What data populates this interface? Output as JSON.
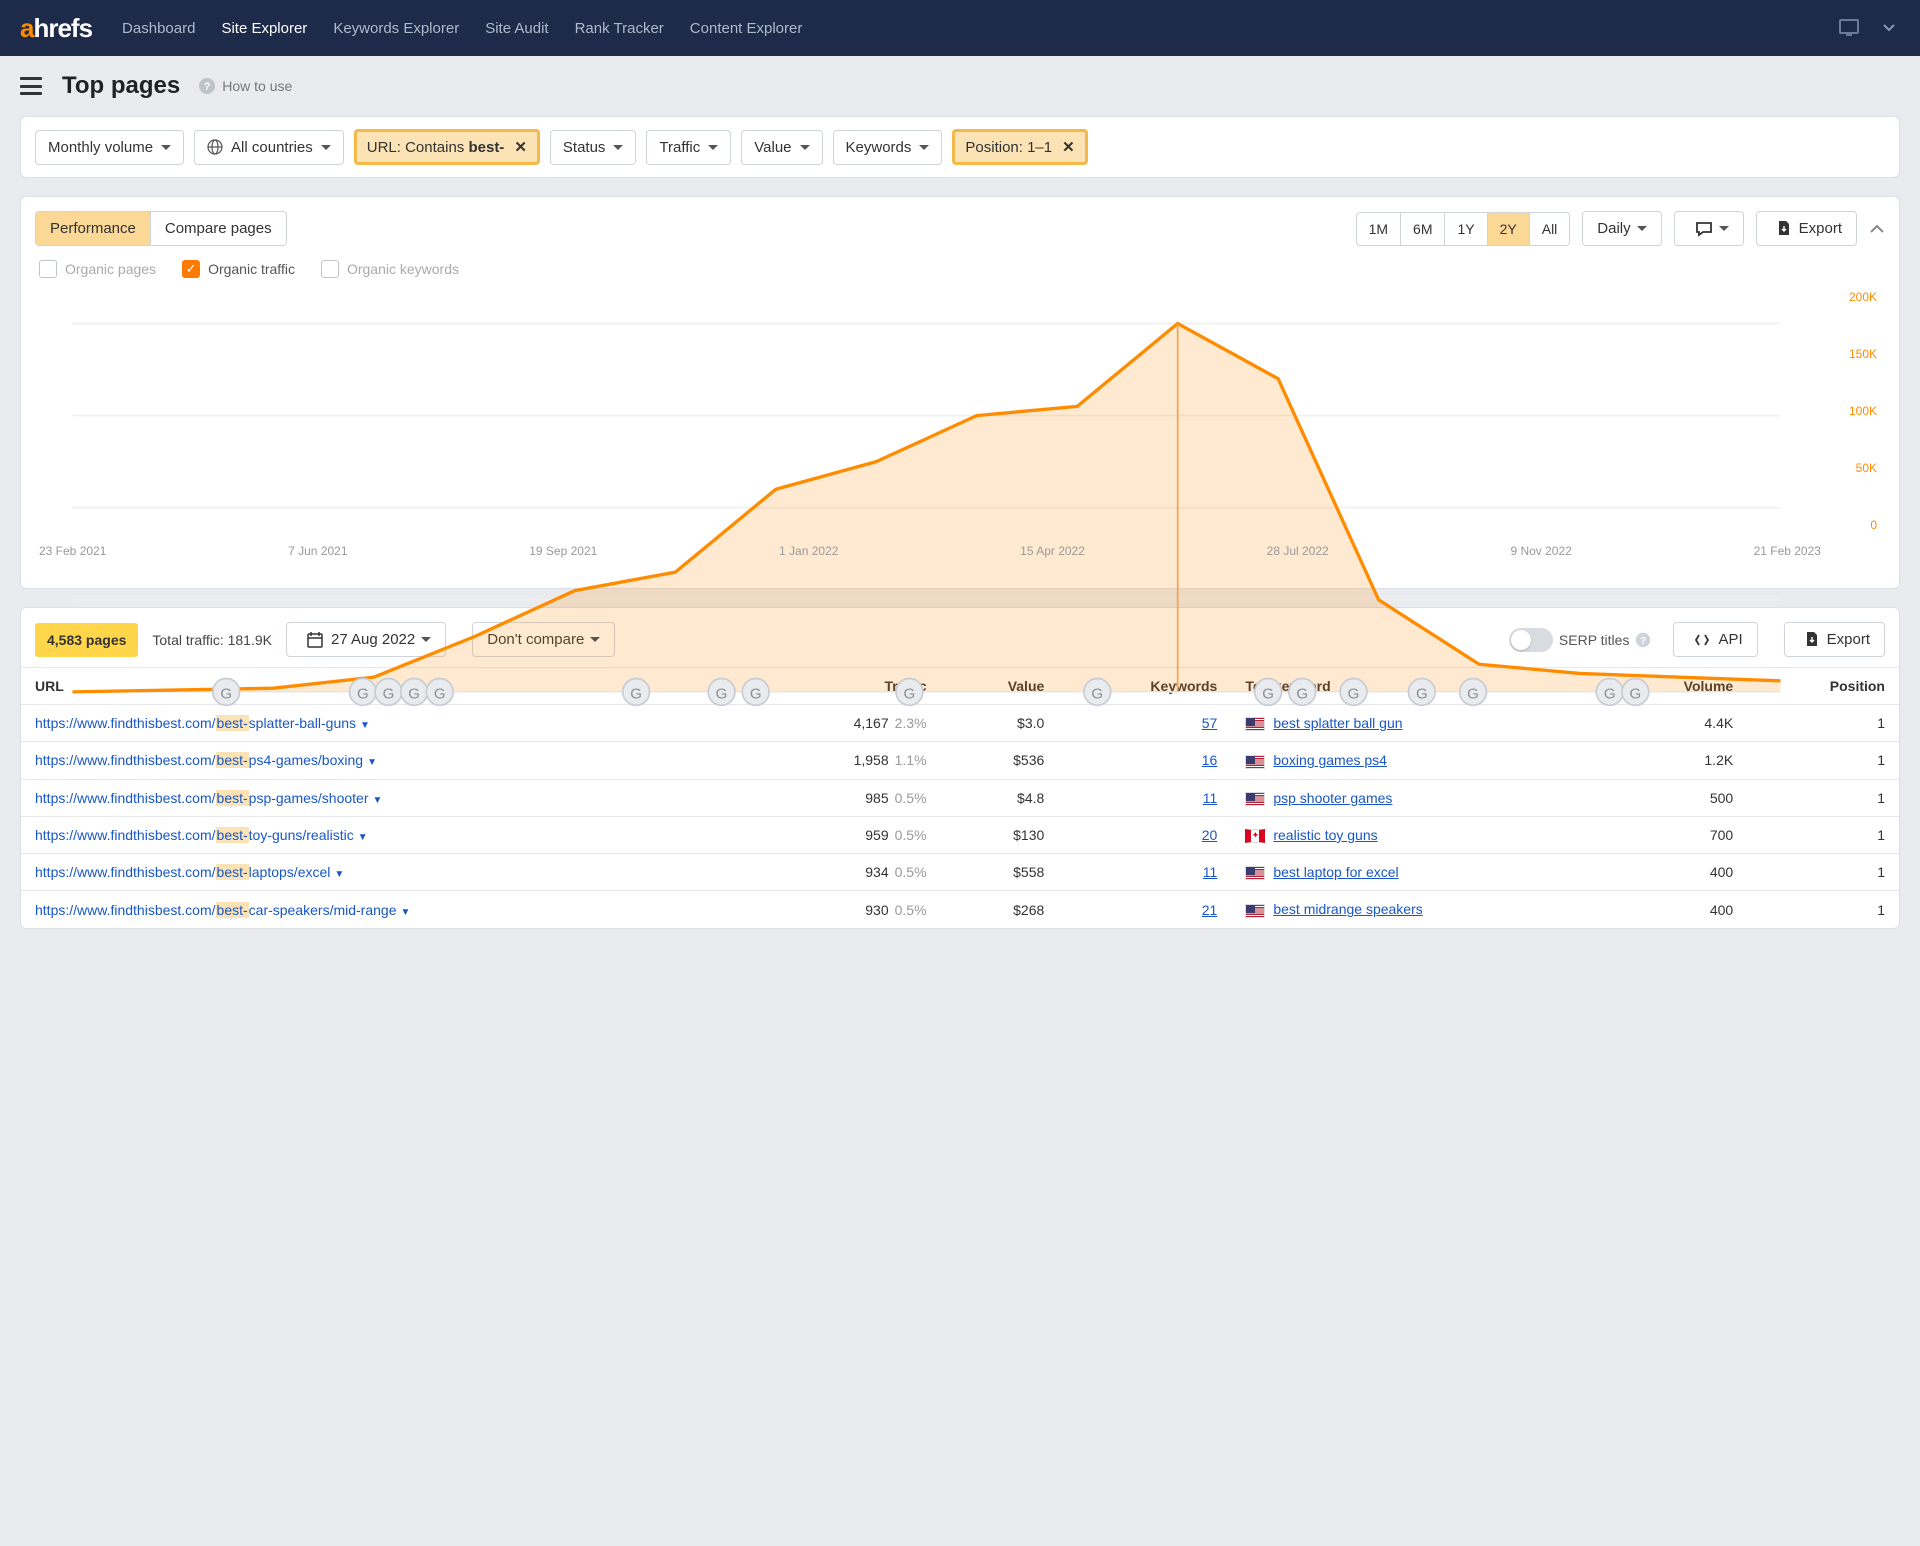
{
  "nav": {
    "logo_a": "a",
    "logo_rest": "hrefs",
    "items": [
      "Dashboard",
      "Site Explorer",
      "Keywords Explorer",
      "Site Audit",
      "Rank Tracker",
      "Content Explorer"
    ],
    "active_index": 1
  },
  "page": {
    "title": "Top pages",
    "how_to_use": "How to use"
  },
  "filters": {
    "monthly_volume": "Monthly volume",
    "countries": "All countries",
    "url_prefix": "URL: Contains ",
    "url_value": "best-",
    "status": "Status",
    "traffic": "Traffic",
    "value": "Value",
    "keywords": "Keywords",
    "position": "Position: 1–1"
  },
  "chart_panel": {
    "tabs": {
      "performance": "Performance",
      "compare": "Compare pages"
    },
    "ranges": [
      "1M",
      "6M",
      "1Y",
      "2Y",
      "All"
    ],
    "range_active": "2Y",
    "granularity": "Daily",
    "export": "Export",
    "legend": {
      "organic_pages": "Organic pages",
      "organic_traffic": "Organic traffic",
      "organic_keywords": "Organic keywords"
    }
  },
  "chart_data": {
    "type": "area",
    "title": "Organic traffic",
    "ylabel": "",
    "ylim": [
      0,
      200000
    ],
    "y_ticks": [
      "200K",
      "150K",
      "100K",
      "50K",
      "0"
    ],
    "x_ticks": [
      "23 Feb 2021",
      "7 Jun 2021",
      "19 Sep 2021",
      "1 Jan 2022",
      "15 Apr 2022",
      "28 Jul 2022",
      "9 Nov 2022",
      "21 Feb 2023"
    ],
    "series": [
      {
        "name": "Organic traffic",
        "color": "#ff8c00",
        "x": [
          "23 Feb 2021",
          "1 May 2021",
          "7 Jun 2021",
          "19 Sep 2021",
          "15 Nov 2021",
          "1 Jan 2022",
          "1 Feb 2022",
          "15 Apr 2022",
          "15 Jun 2022",
          "1 Jul 2022",
          "28 Jul 2022",
          "27 Aug 2022",
          "10 Sep 2022",
          "1 Oct 2022",
          "20 Oct 2022",
          "9 Nov 2022",
          "1 Dec 2022",
          "21 Feb 2023"
        ],
        "y": [
          0,
          1000,
          2000,
          8000,
          30000,
          55000,
          65000,
          110000,
          125000,
          150000,
          155000,
          200000,
          170000,
          50000,
          15000,
          10000,
          8000,
          6000
        ]
      }
    ],
    "markers": {
      "label": "G",
      "x": [
        "1 May 2021",
        "25 Jun 2021",
        "5 Jul 2021",
        "15 Jul 2021",
        "22 Jul 2021",
        "15 Nov 2021",
        "5 Dec 2021",
        "15 Dec 2021",
        "1 Mar 2022",
        "20 May 2022",
        "15 Jul 2022",
        "25 Jul 2022",
        "27 Aug 2022",
        "10 Sep 2022",
        "1 Oct 2022",
        "25 Dec 2022",
        "1 Jan 2023"
      ]
    }
  },
  "pages_panel": {
    "count_badge": "4,583 pages",
    "total_traffic_label": "Total traffic: 181.9K",
    "date": "27 Aug 2022",
    "compare": "Don't compare",
    "serp_titles": "SERP titles",
    "api": "API",
    "export": "Export",
    "headers": {
      "url": "URL",
      "traffic": "Traffic",
      "value": "Value",
      "keywords": "Keywords",
      "topkw": "Top keyword",
      "volume": "Volume",
      "position": "Position"
    },
    "rows": [
      {
        "url_pre": "https://www.findthisbest.com/",
        "hl": "best-",
        "url_post": "splatter-ball-guns",
        "traffic": "4,167",
        "pct": "2.3%",
        "value": "$3.0",
        "keywords": "57",
        "flag": "us",
        "topkw": "best splatter ball gun",
        "volume": "4.4K",
        "position": "1"
      },
      {
        "url_pre": "https://www.findthisbest.com/",
        "hl": "best-",
        "url_post": "ps4-games/boxing",
        "traffic": "1,958",
        "pct": "1.1%",
        "value": "$536",
        "keywords": "16",
        "flag": "us",
        "topkw": "boxing games ps4",
        "volume": "1.2K",
        "position": "1"
      },
      {
        "url_pre": "https://www.findthisbest.com/",
        "hl": "best-",
        "url_post": "psp-games/shooter",
        "traffic": "985",
        "pct": "0.5%",
        "value": "$4.8",
        "keywords": "11",
        "flag": "us",
        "topkw": "psp shooter games",
        "volume": "500",
        "position": "1"
      },
      {
        "url_pre": "https://www.findthisbest.com/",
        "hl": "best-",
        "url_post": "toy-guns/realistic",
        "traffic": "959",
        "pct": "0.5%",
        "value": "$130",
        "keywords": "20",
        "flag": "ca",
        "topkw": "realistic toy guns",
        "volume": "700",
        "position": "1"
      },
      {
        "url_pre": "https://www.findthisbest.com/",
        "hl": "best-",
        "url_post": "laptops/excel",
        "traffic": "934",
        "pct": "0.5%",
        "value": "$558",
        "keywords": "11",
        "flag": "us",
        "topkw": "best laptop for excel",
        "volume": "400",
        "position": "1"
      },
      {
        "url_pre": "https://www.findthisbest.com/",
        "hl": "best-",
        "url_post": "car-speakers/mid-range",
        "traffic": "930",
        "pct": "0.5%",
        "value": "$268",
        "keywords": "21",
        "flag": "us",
        "topkw": "best midrange speakers",
        "volume": "400",
        "position": "1"
      }
    ]
  }
}
